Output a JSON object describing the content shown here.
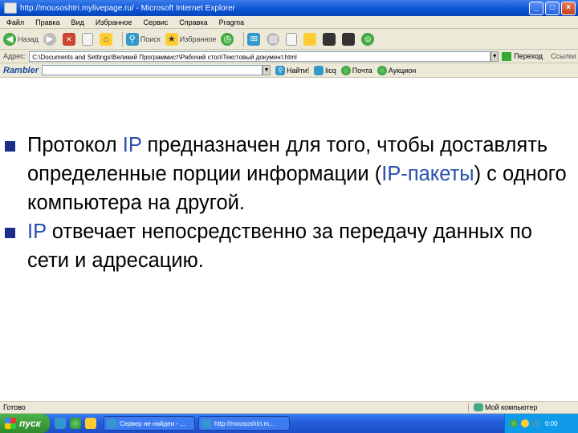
{
  "window": {
    "title": "http://mousoshtri.mylivepage.ru/ - Microsoft Internet Explorer",
    "minimize": "_",
    "maximize": "□",
    "close": "×"
  },
  "menu": [
    "Файл",
    "Правка",
    "Вид",
    "Избранное",
    "Сервис",
    "Справка",
    "Pragma"
  ],
  "toolbar": {
    "back": "Назад",
    "search": "Поиск",
    "favorites": "Избранное"
  },
  "address": {
    "label": "Адрес:",
    "value": "C:\\Documents and Settings\\Великий Программист\\Рабочий стол\\Текстовый документ.html",
    "go": "Переход",
    "links": "Ссылки"
  },
  "rambler": {
    "logo": "Rambler",
    "find": "Найти!",
    "lcq": "licq",
    "mail": "Почта",
    "auction": "Аукцион"
  },
  "content": {
    "bullets": [
      {
        "parts": [
          {
            "text": "Протокол ",
            "hl": false
          },
          {
            "text": "IP",
            "hl": true
          },
          {
            "text": " предназначен для того, чтобы доставлять определенные порции информации (",
            "hl": false
          },
          {
            "text": "IP-пакеты",
            "hl": true
          },
          {
            "text": ") с одного компьютера на другой.",
            "hl": false
          }
        ]
      },
      {
        "parts": [
          {
            "text": "IP",
            "hl": true
          },
          {
            "text": " отвечает непосредственно за передачу данных по сети и адресацию.",
            "hl": false
          }
        ]
      }
    ]
  },
  "status": {
    "text": "Готово",
    "zone": "Мой компьютер"
  },
  "taskbar": {
    "start": "пуск",
    "tasks": [
      "Сервер не найден - ...",
      "http://mousoshtri.m..."
    ],
    "clock": "0:00"
  }
}
